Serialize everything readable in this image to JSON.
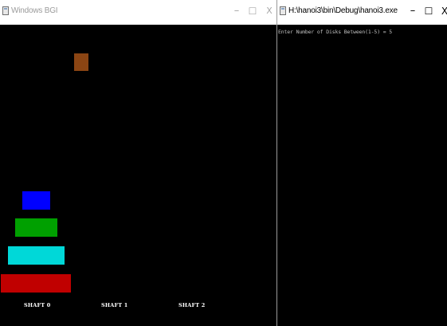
{
  "bgi_window": {
    "title": "Windows BGI",
    "controls": {
      "minimize": "–",
      "maximize": "☐",
      "close": "X"
    },
    "moving_disk": {
      "color": "#8b4513"
    },
    "stacked_disks": [
      {
        "color": "#0000ff"
      },
      {
        "color": "#00a000"
      },
      {
        "color": "#00d8d8"
      },
      {
        "color": "#c00000"
      }
    ],
    "shafts": [
      {
        "label": "SHAFT 0"
      },
      {
        "label": "SHAFT 1"
      },
      {
        "label": "SHAFT 2"
      }
    ]
  },
  "console_window": {
    "title": "H:\\hanoi3\\bin\\Debug\\hanoi3.exe",
    "controls": {
      "minimize": "–",
      "maximize": "☐",
      "close": "X"
    },
    "output_line": "Enter Number of Disks Between(1-5) = 5"
  }
}
